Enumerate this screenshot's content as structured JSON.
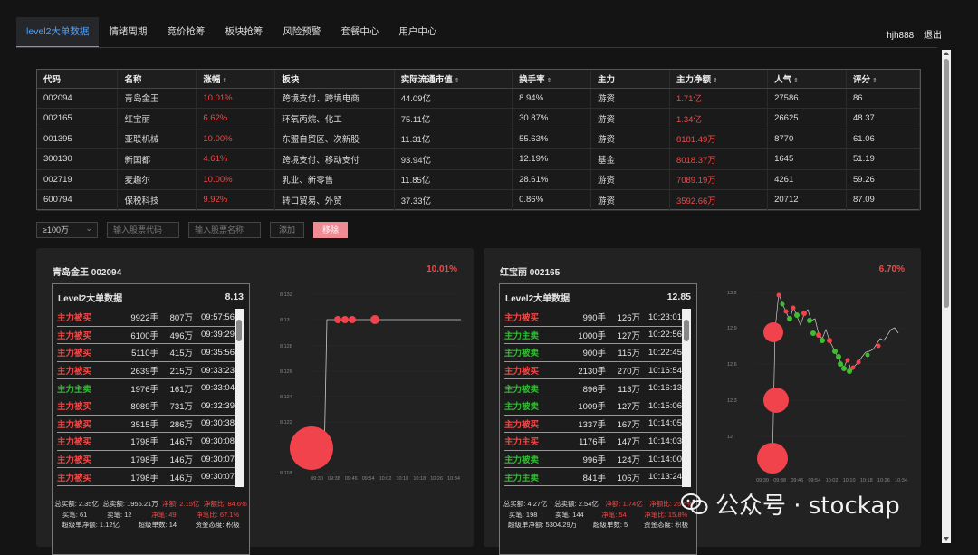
{
  "nav": {
    "tabs": [
      "level2大单数据",
      "情绪周期",
      "竞价抢筹",
      "板块抢筹",
      "风险预警",
      "套餐中心",
      "用户中心"
    ],
    "user": "hjh888",
    "logout": "退出"
  },
  "table": {
    "headers": [
      "代码",
      "名称",
      "涨幅",
      "板块",
      "实际流通市值",
      "换手率",
      "主力",
      "主力净额",
      "人气",
      "评分"
    ],
    "rows": [
      [
        "002094",
        "青岛金王",
        "10.01%",
        "跨境支付、跨境电商",
        "44.09亿",
        "8.94%",
        "游资",
        "1.71亿",
        "27586",
        "86"
      ],
      [
        "002165",
        "红宝丽",
        "6.62%",
        "环氧丙烷、化工",
        "75.11亿",
        "30.87%",
        "游资",
        "1.34亿",
        "26625",
        "48.37"
      ],
      [
        "001395",
        "亚联机械",
        "10.00%",
        "东盟自贸区、次新股",
        "11.31亿",
        "55.63%",
        "游资",
        "8181.49万",
        "8770",
        "61.06"
      ],
      [
        "300130",
        "新国都",
        "4.61%",
        "跨境支付、移动支付",
        "93.94亿",
        "12.19%",
        "基金",
        "8018.37万",
        "1645",
        "51.19"
      ],
      [
        "002719",
        "麦趣尔",
        "10.00%",
        "乳业、新零售",
        "11.85亿",
        "28.61%",
        "游资",
        "7089.19万",
        "4261",
        "59.26"
      ],
      [
        "600794",
        "保税科技",
        "9.92%",
        "转口贸易、外贸",
        "37.33亿",
        "0.86%",
        "游资",
        "3592.66万",
        "20712",
        "87.09"
      ]
    ]
  },
  "filters": {
    "select": "≥100万",
    "code_placeholder": "输入股票代码",
    "name_placeholder": "输入股票名称",
    "add": "添加",
    "remove": "移除"
  },
  "cards": [
    {
      "title": "青岛金王 002094",
      "pct": "10.01%",
      "panel_title": "Level2大单数据",
      "price": "8.13",
      "rows": [
        [
          "主力被买",
          "9922手",
          "807万",
          "09:57:56",
          "buy"
        ],
        [
          "主力被买",
          "6100手",
          "496万",
          "09:39:29",
          "buy"
        ],
        [
          "主力被买",
          "5110手",
          "415万",
          "09:35:56",
          "buy"
        ],
        [
          "主力被买",
          "2639手",
          "215万",
          "09:33:23",
          "buy"
        ],
        [
          "主力主卖",
          "1976手",
          "161万",
          "09:33:04",
          "sell"
        ],
        [
          "主力被买",
          "8989手",
          "731万",
          "09:32:39",
          "buy"
        ],
        [
          "主力被买",
          "3515手",
          "286万",
          "09:30:38",
          "buy"
        ],
        [
          "主力被买",
          "1798手",
          "146万",
          "09:30:08",
          "buy"
        ],
        [
          "主力被买",
          "1798手",
          "146万",
          "09:30:07",
          "buy"
        ],
        [
          "主力被买",
          "1798手",
          "146万",
          "09:30:07",
          "buy"
        ]
      ],
      "summary": [
        [
          [
            "总买额: 2.35亿",
            ""
          ],
          [
            "总卖额: 1956.21万",
            ""
          ],
          [
            "净额: 2.15亿",
            "red"
          ],
          [
            "净额比: 84.6%",
            "red"
          ]
        ],
        [
          [
            "买笔: 61",
            ""
          ],
          [
            "卖笔: 12",
            ""
          ],
          [
            "净笔: 49",
            "red"
          ],
          [
            "净笔比: 67.1%",
            "red"
          ]
        ],
        [
          [
            "超级单净额: 1.12亿",
            ""
          ],
          [
            "超级单数: 14",
            ""
          ],
          [
            "资金态度: 积极",
            ""
          ]
        ]
      ],
      "chart": {
        "yticks": [
          "8.132",
          "8.13",
          "8.128",
          "8.126",
          "8.124",
          "8.122",
          "8.118"
        ],
        "xticks": [
          "09:30",
          "09:38",
          "09:46",
          "09:54",
          "10:02",
          "10:10",
          "10:18",
          "10:26",
          "10:34"
        ]
      }
    },
    {
      "title": "红宝丽 002165",
      "pct": "6.70%",
      "panel_title": "Level2大单数据",
      "price": "12.85",
      "rows": [
        [
          "主力被买",
          "990手",
          "126万",
          "10:23:01",
          "buy"
        ],
        [
          "主力主卖",
          "1000手",
          "127万",
          "10:22:56",
          "sell"
        ],
        [
          "主力被卖",
          "900手",
          "115万",
          "10:22:45",
          "sell"
        ],
        [
          "主力被买",
          "2130手",
          "270万",
          "10:16:54",
          "buy"
        ],
        [
          "主力被卖",
          "896手",
          "113万",
          "10:16:13",
          "sell"
        ],
        [
          "主力被卖",
          "1009手",
          "127万",
          "10:15:06",
          "sell"
        ],
        [
          "主力被买",
          "1337手",
          "167万",
          "10:14:05",
          "buy"
        ],
        [
          "主力主买",
          "1176手",
          "147万",
          "10:14:03",
          "buy"
        ],
        [
          "主力被卖",
          "996手",
          "124万",
          "10:14:00",
          "sell"
        ],
        [
          "主力主卖",
          "841手",
          "106万",
          "10:13:24",
          "sell"
        ]
      ],
      "summary": [
        [
          [
            "总买额: 4.27亿",
            ""
          ],
          [
            "总卖额: 2.54亿",
            ""
          ],
          [
            "净额: 1.74亿",
            "red"
          ],
          [
            "净额比: 25.5%",
            "red"
          ]
        ],
        [
          [
            "买笔: 198",
            ""
          ],
          [
            "卖笔: 144",
            ""
          ],
          [
            "净笔: 54",
            "red"
          ],
          [
            "净笔比: 15.8%",
            "red"
          ]
        ],
        [
          [
            "超级单净额: 5304.29万",
            ""
          ],
          [
            "超级单数: 5",
            ""
          ],
          [
            "资金态度: 积极",
            ""
          ]
        ]
      ],
      "chart": {
        "yticks": [
          "13.2",
          "12.9",
          "12.6",
          "12.3",
          "12"
        ],
        "xticks": [
          "09:30",
          "09:38",
          "09:46",
          "09:54",
          "10:02",
          "10:10",
          "10:18",
          "10:26",
          "10:34"
        ]
      }
    }
  ],
  "watermark": "公众号 · stockap",
  "colors": {
    "up": "#f04848",
    "down": "#33bb33",
    "accent": "#4da3ff",
    "bg": "#141414",
    "card": "#222222"
  }
}
